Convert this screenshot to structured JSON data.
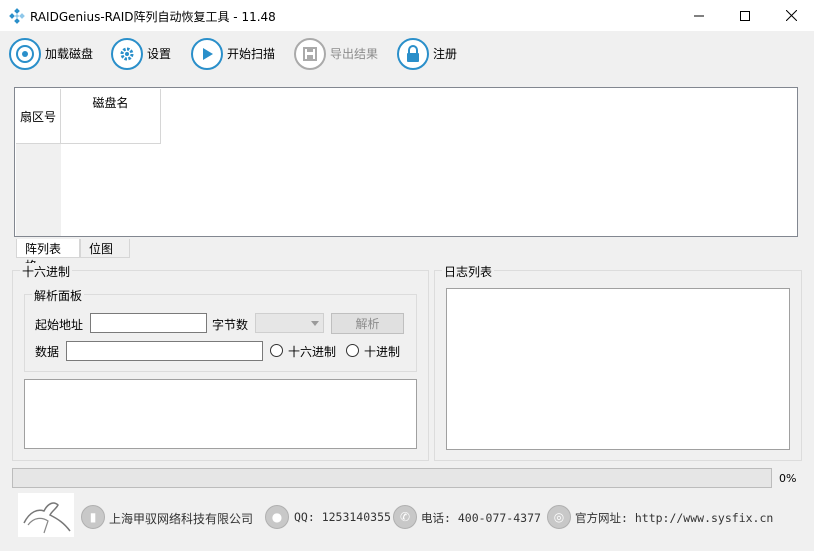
{
  "window": {
    "title": "RAIDGenius-RAID阵列自动恢复工具 - 11.48",
    "icon": "raid-diamond-icon",
    "controls": {
      "minimize": "minimize-icon",
      "maximize": "maximize-icon",
      "close": "close-icon"
    }
  },
  "toolbar": {
    "load_disk": {
      "label": "加载磁盘",
      "icon": "disk-icon"
    },
    "settings": {
      "label": "设置",
      "icon": "gear-icon"
    },
    "start_scan": {
      "label": "开始扫描",
      "icon": "play-icon"
    },
    "export_result": {
      "label": "导出结果",
      "icon": "save-icon",
      "disabled": true
    },
    "register": {
      "label": "注册",
      "icon": "lock-icon"
    }
  },
  "grid": {
    "row_header_label": "扇区号",
    "columns": [
      "磁盘名"
    ]
  },
  "tabs": [
    {
      "label": "阵列表格",
      "active": true
    },
    {
      "label": "位图",
      "active": false
    }
  ],
  "hex_panel": {
    "title": "十六进制",
    "parse_panel": {
      "title": "解析面板",
      "start_address_label": "起始地址",
      "start_address_value": "",
      "byte_count_label": "字节数",
      "byte_count_value": "",
      "parse_button": "解析",
      "data_label": "数据",
      "data_value": "",
      "radio_hex": "十六进制",
      "radio_dec": "十进制"
    }
  },
  "log_panel": {
    "title": "日志列表"
  },
  "progress": {
    "value": 0,
    "label": "0%"
  },
  "footer": {
    "company": "上海甲驭网络科技有限公司",
    "qq": "QQ: 1253140355",
    "phone": "电话: 400-077-4377",
    "website": "官方网址: http://www.sysfix.cn",
    "icons": [
      "horse-logo-icon",
      "building-icon",
      "qq-penguin-icon",
      "phone-icon",
      "globe-icon"
    ]
  },
  "colors": {
    "accent": "#2a8fca",
    "progress": "#06b025",
    "disabled": "#8c8c8c"
  }
}
